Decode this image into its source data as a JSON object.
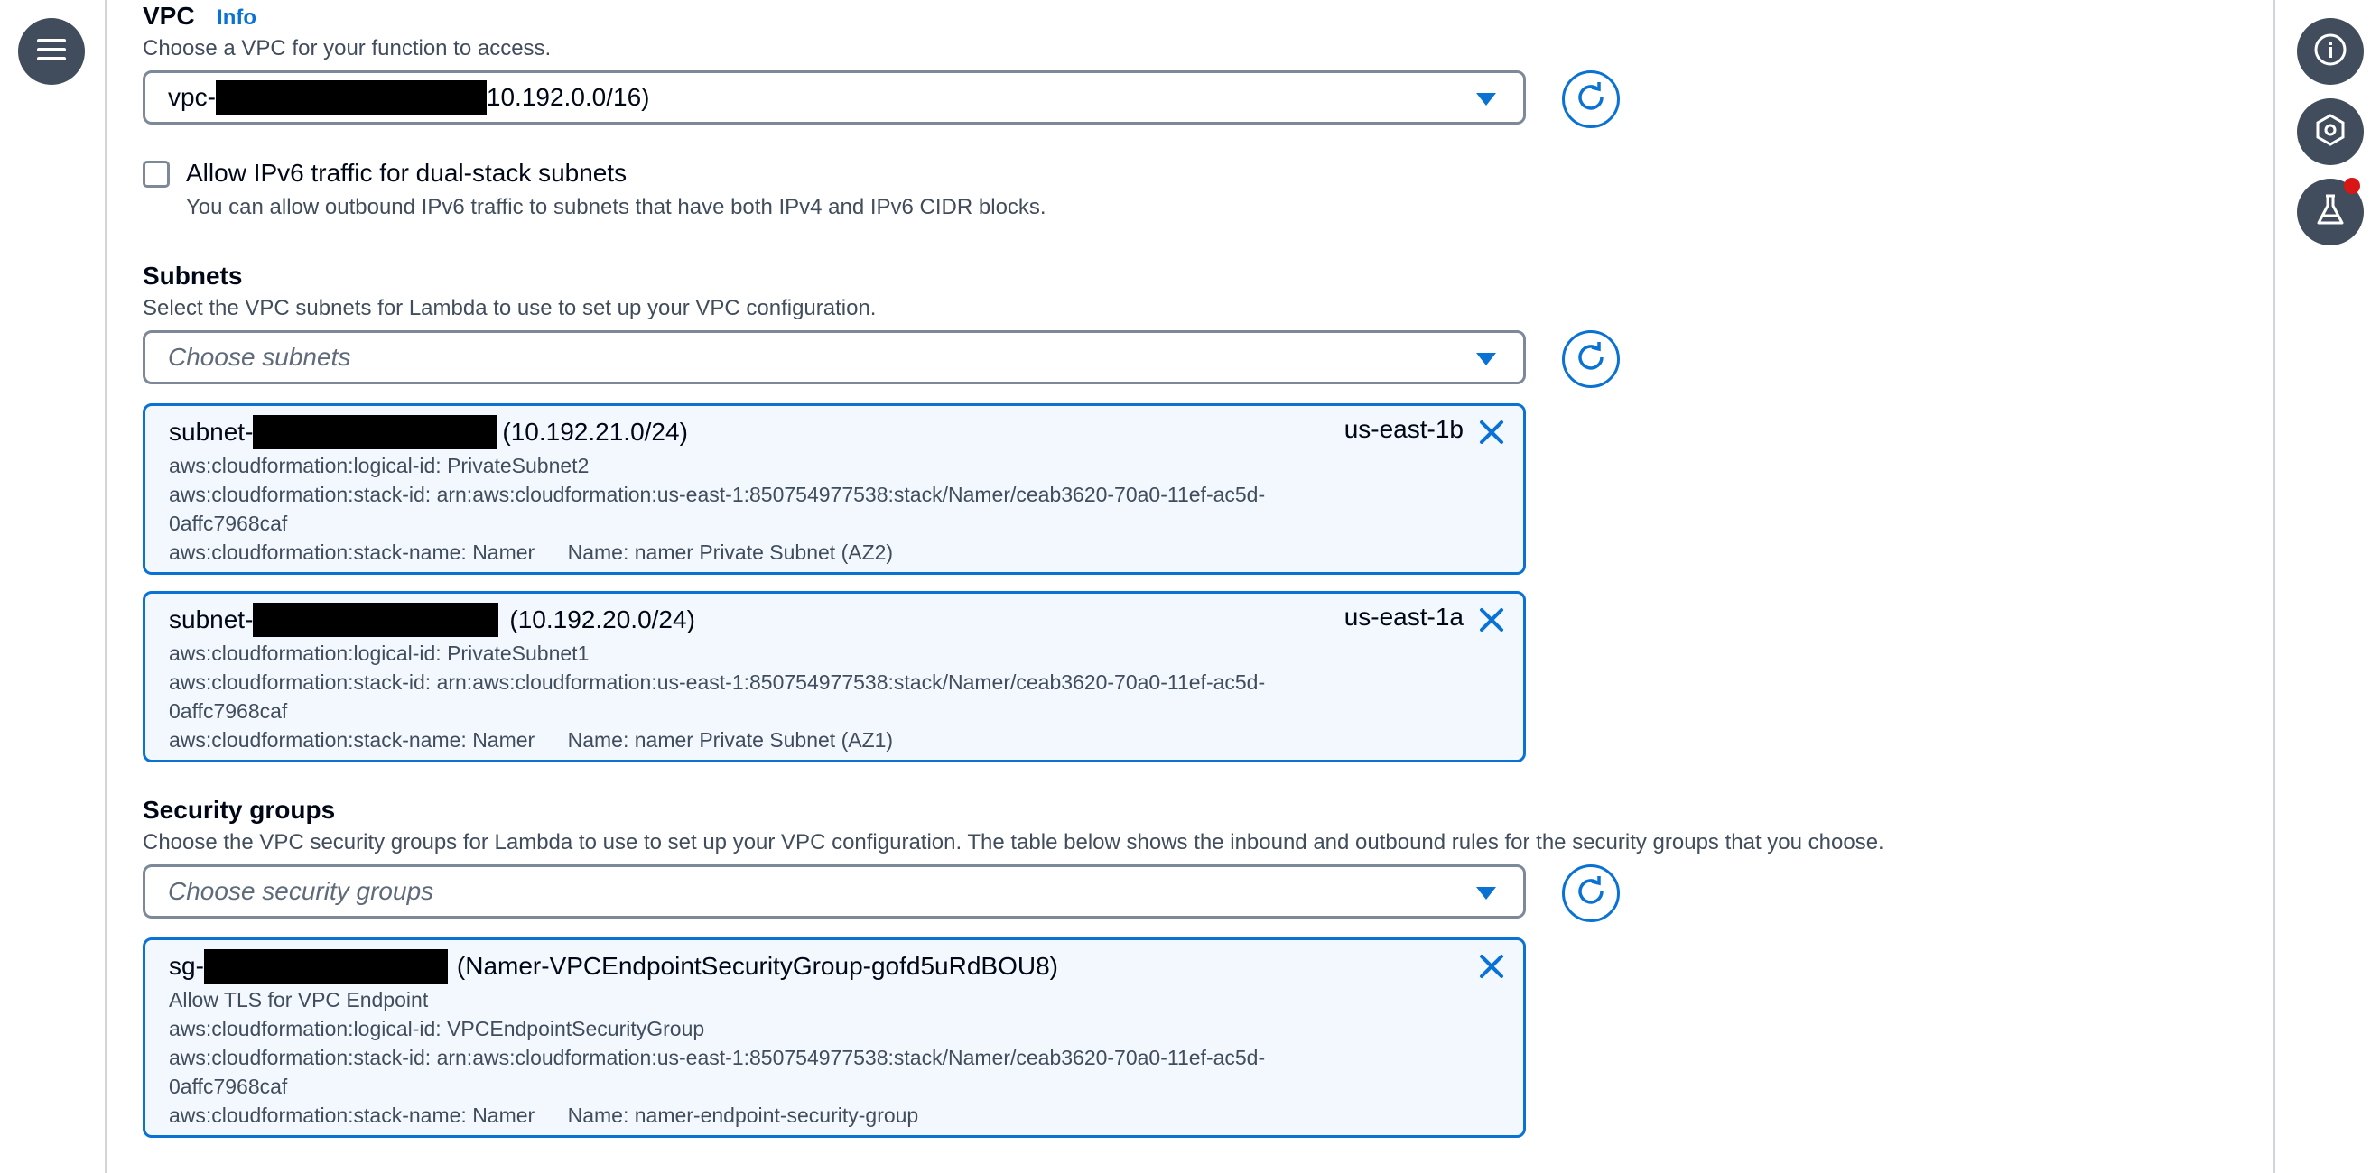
{
  "vpc": {
    "label": "VPC",
    "info": "Info",
    "description": "Choose a VPC for your function to access.",
    "value_prefix": "vpc-",
    "value_suffix": "10.192.0.0/16)"
  },
  "ipv6": {
    "label": "Allow IPv6 traffic for dual-stack subnets",
    "description": "You can allow outbound IPv6 traffic to subnets that have both IPv4 and IPv6 CIDR blocks.",
    "checked": false
  },
  "subnets": {
    "label": "Subnets",
    "description": "Select the VPC subnets for Lambda to use to set up your VPC configuration.",
    "placeholder": "Choose subnets",
    "selected": [
      {
        "prefix": "subnet-",
        "suffix": "(10.192.21.0/24)",
        "zone": "us-east-1b",
        "logical_id": "aws:cloudformation:logical-id: PrivateSubnet2",
        "stack_id_1": "aws:cloudformation:stack-id: arn:aws:cloudformation:us-east-1:850754977538:stack/Namer/ceab3620-70a0-11ef-ac5d-",
        "stack_id_2": "0affc7968caf",
        "stack_name": "aws:cloudformation:stack-name: Namer",
        "name": "Name: namer Private Subnet (AZ2)"
      },
      {
        "prefix": "subnet-",
        "suffix": "(10.192.20.0/24)",
        "zone": "us-east-1a",
        "logical_id": "aws:cloudformation:logical-id: PrivateSubnet1",
        "stack_id_1": "aws:cloudformation:stack-id: arn:aws:cloudformation:us-east-1:850754977538:stack/Namer/ceab3620-70a0-11ef-ac5d-",
        "stack_id_2": "0affc7968caf",
        "stack_name": "aws:cloudformation:stack-name: Namer",
        "name": "Name: namer Private Subnet (AZ1)"
      }
    ]
  },
  "security_groups": {
    "label": "Security groups",
    "description": "Choose the VPC security groups for Lambda to use to set up your VPC configuration. The table below shows the inbound and outbound rules for the security groups that you choose.",
    "placeholder": "Choose security groups",
    "selected": [
      {
        "prefix": "sg-",
        "suffix": "(Namer-VPCEndpointSecurityGroup-gofd5uRdBOU8)",
        "group_description": "Allow TLS for VPC Endpoint",
        "logical_id": "aws:cloudformation:logical-id: VPCEndpointSecurityGroup",
        "stack_id_1": "aws:cloudformation:stack-id: arn:aws:cloudformation:us-east-1:850754977538:stack/Namer/ceab3620-70a0-11ef-ac5d-",
        "stack_id_2": "0affc7968caf",
        "stack_name": "aws:cloudformation:stack-name: Namer",
        "name": "Name: namer-endpoint-security-group"
      }
    ]
  },
  "icons": {
    "menu": "hamburger-menu-icon",
    "info_panel": "info-icon",
    "settings": "hexagon-settings-icon",
    "labs": "flask-icon",
    "refresh": "refresh-icon",
    "remove": "close-icon",
    "dropdown": "caret-down-icon"
  },
  "colors": {
    "accent": "#0972d3",
    "dark_button": "#414d5c",
    "token_bg": "#f2f8fd",
    "notification": "#d91515"
  }
}
